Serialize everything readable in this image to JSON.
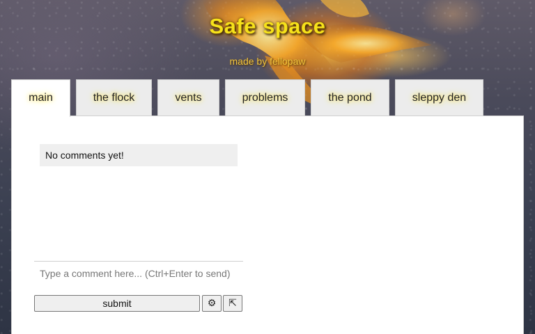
{
  "site": {
    "title": "Safe space",
    "subtitle": "made by fellopaw"
  },
  "tabs": [
    {
      "label": "main",
      "active": true
    },
    {
      "label": "the flock",
      "active": false
    },
    {
      "label": "vents",
      "active": false
    },
    {
      "label": "problems",
      "active": false
    },
    {
      "label": "the pond",
      "active": false
    },
    {
      "label": "sleppy den",
      "active": false
    }
  ],
  "comments": {
    "empty_message": "No comments yet!",
    "input_placeholder": "Type a comment here... (Ctrl+Enter to send)",
    "input_value": "",
    "submit_label": "submit",
    "settings_icon": "gear-icon",
    "settings_glyph": "⚙",
    "popout_icon": "popout-arrow-icon",
    "popout_glyph": "⇱"
  },
  "colors": {
    "title": "#f6e21a",
    "subtitle": "#f0c33c",
    "tab_glow": "#ffe86a"
  }
}
